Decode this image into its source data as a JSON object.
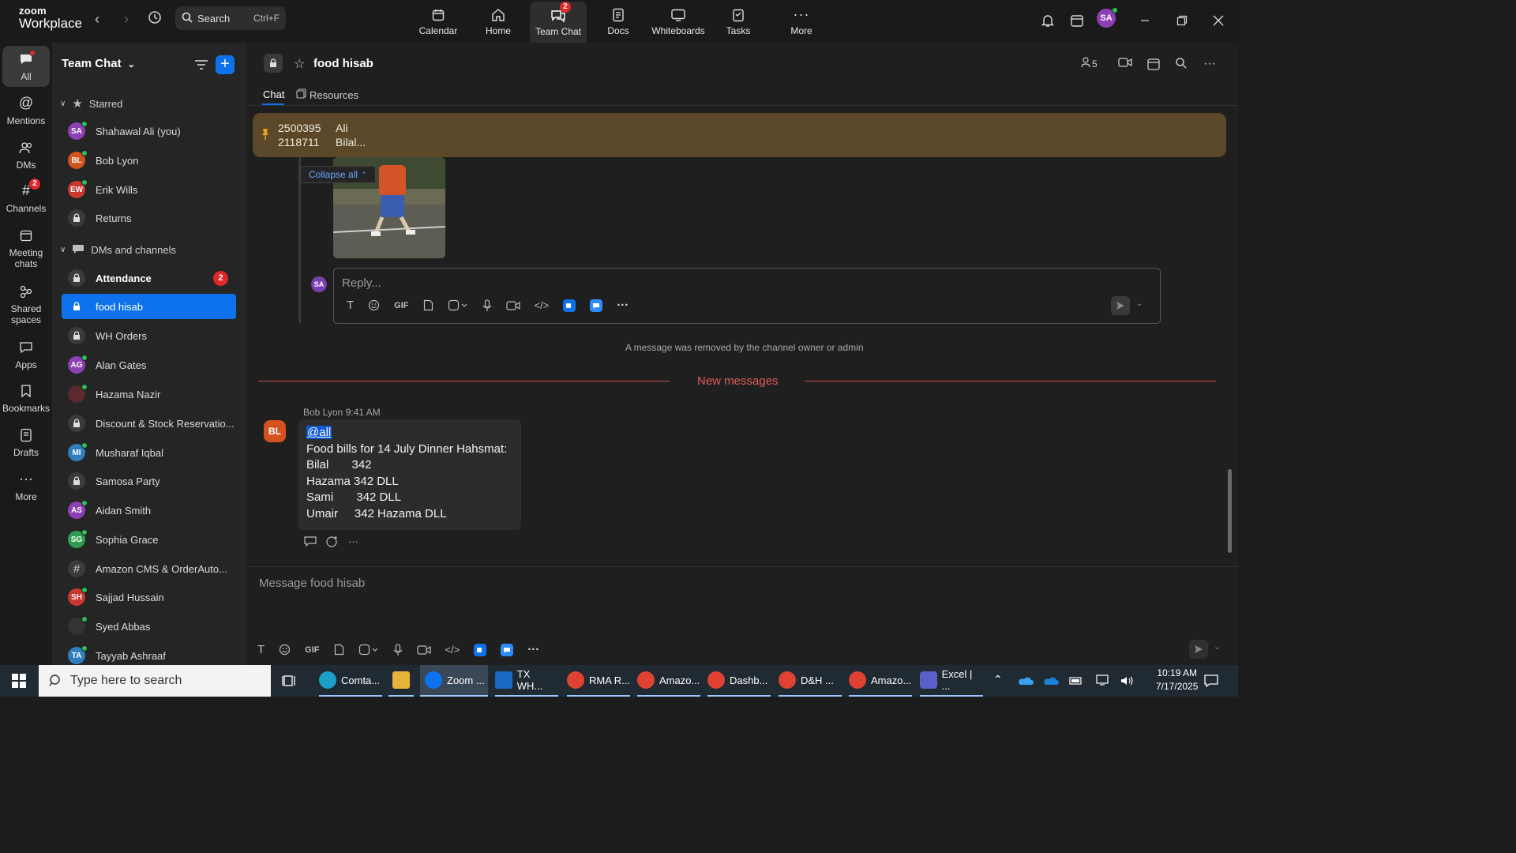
{
  "app": {
    "logo_line1": "zoom",
    "logo_line2": "Workplace"
  },
  "search": {
    "label": "Search",
    "shortcut": "Ctrl+F"
  },
  "top_nav": [
    {
      "label": "Calendar",
      "icon": "calendar-icon"
    },
    {
      "label": "Home",
      "icon": "home-icon"
    },
    {
      "label": "Team Chat",
      "icon": "team-chat-icon",
      "badge": "2",
      "active": true
    },
    {
      "label": "Docs",
      "icon": "docs-icon"
    },
    {
      "label": "Whiteboards",
      "icon": "whiteboard-icon"
    },
    {
      "label": "Tasks",
      "icon": "tasks-icon"
    },
    {
      "label": "More",
      "icon": "more-icon"
    }
  ],
  "user": {
    "initials": "SA",
    "color": "#8e3fb5"
  },
  "rail": [
    {
      "label": "All",
      "active": true
    },
    {
      "label": "Mentions"
    },
    {
      "label": "DMs"
    },
    {
      "label": "Channels",
      "badge": "2"
    },
    {
      "label": "Meeting chats"
    },
    {
      "label": "Shared spaces"
    },
    {
      "label": "Apps"
    },
    {
      "label": "Bookmarks"
    },
    {
      "label": "Drafts"
    },
    {
      "label": "More"
    }
  ],
  "sidebar": {
    "title": "Team Chat",
    "starred_label": "Starred",
    "starred": [
      {
        "label": "Shahawal Ali (you)",
        "initials": "SA",
        "color": "#8e3fb5",
        "online": true
      },
      {
        "label": "Bob Lyon",
        "initials": "BL",
        "color": "#d4521e",
        "online": true
      },
      {
        "label": "Erik Wills",
        "initials": "EW",
        "color": "#c9382e",
        "online": true
      },
      {
        "label": "Returns",
        "lock": true
      }
    ],
    "dms_label": "DMs and channels",
    "items": [
      {
        "label": "Attendance",
        "lock": true,
        "bold": true,
        "unread": "2"
      },
      {
        "label": "food hisab",
        "lock": true,
        "selected": true
      },
      {
        "label": "WH Orders",
        "lock": true
      },
      {
        "label": "Alan Gates",
        "initials": "AG",
        "color": "#8e3fb5",
        "online": true
      },
      {
        "label": "Hazama Nazir",
        "initials": "",
        "color": "#5a2a30",
        "online": true
      },
      {
        "label": "Discount & Stock Reservatio...",
        "lock": true
      },
      {
        "label": "Musharaf Iqbal",
        "initials": "MI",
        "color": "#2f7fbf",
        "online": true
      },
      {
        "label": "Samosa Party",
        "lock": true
      },
      {
        "label": "Aidan Smith",
        "initials": "AS",
        "color": "#8e3fb5",
        "online": true
      },
      {
        "label": "Sophia Grace",
        "initials": "SG",
        "color": "#2e9e4e",
        "online": true
      },
      {
        "label": "Amazon CMS & OrderAuto...",
        "hash": true
      },
      {
        "label": "Sajjad Hussain",
        "initials": "SH",
        "color": "#c9382e",
        "online": true
      },
      {
        "label": "Syed Abbas",
        "initials": "",
        "color": "#333333",
        "online": true
      },
      {
        "label": "Tayyab Ashraaf",
        "initials": "TA",
        "color": "#2f7fbf",
        "online": true
      }
    ]
  },
  "channel": {
    "title": "food hisab",
    "members": "5",
    "tabs": [
      "Chat",
      "Resources"
    ],
    "pinned_line1_a": "2500395",
    "pinned_line1_b": "Ali",
    "pinned_line2_a": "2118711",
    "pinned_line2_b": "Bilal...",
    "collapse_label": "Collapse all",
    "reply_avatar": "SA",
    "reply_placeholder": "Reply...",
    "removed_notice": "A message was removed by the channel owner or admin",
    "new_messages": "New messages",
    "message": {
      "sender": "Bob Lyon",
      "time": "9:41 AM",
      "initials": "BL",
      "mention": "@all",
      "lines": [
        "Food bills for 14 July Dinner Hahsmat:",
        "Bilal       342",
        "Hazama 342 DLL",
        "Sami       342 DLL",
        "Umair     342 Hazama DLL"
      ]
    },
    "composer_placeholder": "Message food hisab",
    "toolbar_gif": "GIF"
  },
  "taskbar": {
    "search_placeholder": "Type here to search",
    "apps": [
      {
        "label": "Comta...",
        "color": "#1aa0c8"
      },
      {
        "label": "",
        "color": "#e7b43a"
      },
      {
        "label": "Zoom ...",
        "color": "#0e72ed",
        "active": true
      },
      {
        "label": "TX WH...",
        "color": "#1769c4"
      },
      {
        "label": "RMA R...",
        "color": "#e04232"
      },
      {
        "label": "Amazo...",
        "color": "#e04232"
      },
      {
        "label": "Dashb...",
        "color": "#e04232"
      },
      {
        "label": "D&H ...",
        "color": "#e04232"
      },
      {
        "label": "Amazo...",
        "color": "#e04232"
      },
      {
        "label": "Excel | ...",
        "color": "#5b5fc7"
      }
    ],
    "time": "10:19 AM",
    "date": "7/17/2025"
  }
}
